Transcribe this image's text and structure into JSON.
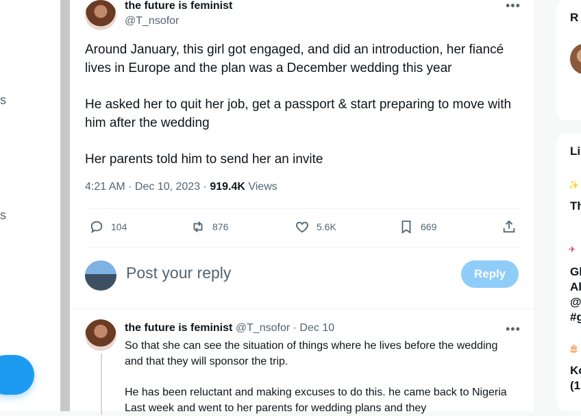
{
  "left_nav": {
    "fragments": [
      "s",
      "s"
    ]
  },
  "tweet": {
    "author_name": "the future is feminist",
    "author_handle": "@T_nsofor",
    "more_icon": "more-horizontal-icon",
    "paragraphs": [
      "Around January, this girl got engaged, and did an introduction, her fiancé lives in Europe and the plan was a December wedding this year",
      "He asked her to quit her job, get a passport & start preparing to move with him after the wedding",
      "Her parents told him to send her an invite"
    ],
    "time_date": "4:21 AM · Dec 10, 2023 · ",
    "views_count": "919.4K",
    "views_label": " Views",
    "actions": {
      "replies": "104",
      "reposts": "876",
      "likes": "5.6K",
      "bookmarks": "669"
    }
  },
  "reply_composer": {
    "placeholder": "Post your reply",
    "button_label": "Reply"
  },
  "reply_tweet": {
    "author_name": "the future is feminist",
    "author_handle": "@T_nsofor",
    "date": " · Dec 10",
    "paragraphs": [
      "So that she can see the situation of things where he lives before the wedding and that they will sponsor the trip.",
      "He has been reluctant and making excuses to do this. he  came back to Nigeria Last week and went to her parents for wedding plans and they"
    ]
  },
  "right_sidebar": {
    "card1_title_fragment": "R",
    "card2_title_fragment": "Li",
    "items": [
      {
        "icon": "✨",
        "text": "Th"
      },
      {
        "icon": "✈",
        "text": "Gl"
      },
      {
        "icon": "",
        "text": "Al"
      },
      {
        "icon": "",
        "text": "@"
      },
      {
        "icon": "",
        "text": "#g"
      },
      {
        "icon": "🎂",
        "text": "Ko"
      },
      {
        "icon": "",
        "text": "(1:"
      }
    ]
  }
}
